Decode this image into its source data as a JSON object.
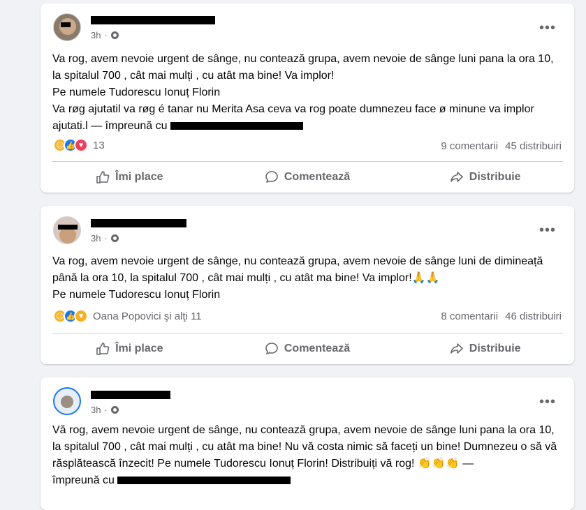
{
  "actions": {
    "like_label": "Îmi place",
    "comment_label": "Comentează",
    "share_label": "Distribuie"
  },
  "posts": [
    {
      "time": "3h",
      "more": "•••",
      "lines": [
        "Va rog, avem nevoie urgent de sânge, nu contează grupa, avem nevoie de sânge  luni pana la ora 10, la spitalul 700 , cât mai mulți , cu atât ma bine! Va implor!",
        "Pe numele Tudorescu Ionuț Florin",
        "Va røg ajutatil va røg é tanar nu Merita Asa ceva va rog poate dumnezeu face ø minune va implor"
      ],
      "tag_prefix": "ajutati.l — împreună cu",
      "reaction_count": "13",
      "comments": "9 comentarii",
      "shares": "45 distribuiri"
    },
    {
      "time": "3h",
      "more": "•••",
      "lines": [
        "Va rog, avem nevoie urgent de sânge, nu contează grupa, avem nevoie de sânge luni de dimineață până la ora 10, la spitalul 700 , cât mai mulți , cu atât ma bine! Va implor!🙏🙏",
        "Pe numele Tudorescu Ionuț Florin"
      ],
      "reaction_text": "Oana Popovici şi alţi 11",
      "comments": "8 comentarii",
      "shares": "46 distribuiri"
    },
    {
      "time": "3h",
      "more": "•••",
      "lines": [
        "Vă rog, avem nevoie urgent de sânge, nu contează grupa, avem nevoie de sânge  luni pana la ora 10, la spitalul 700 , cât mai mulți , cu atât ma bine! Nu vă costa nimic să faceți un bine! Dumnezeu o să vă răsplătească înzecit! Pe numele Tudorescu Ionuț Florin! Distribuiți vă rog! 👏👏👏 —"
      ],
      "tag_prefix": "împreună cu"
    }
  ]
}
